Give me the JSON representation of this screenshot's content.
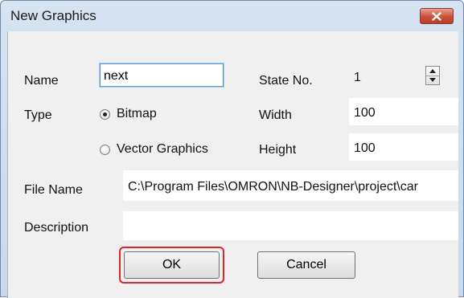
{
  "window": {
    "title": "New Graphics",
    "close_glyph": "close-x-icon"
  },
  "form": {
    "name": {
      "label": "Name",
      "value": "next"
    },
    "state_no": {
      "label": "State No.",
      "value": "1"
    },
    "type": {
      "label": "Type",
      "options": [
        {
          "label": "Bitmap",
          "selected": true
        },
        {
          "label": "Vector Graphics",
          "selected": false
        }
      ]
    },
    "width": {
      "label": "Width",
      "value": "100"
    },
    "height": {
      "label": "Height",
      "value": "100"
    },
    "file_name": {
      "label": "File Name",
      "value": "C:\\Program Files\\OMRON\\NB-Designer\\project\\car"
    },
    "description": {
      "label": "Description",
      "value": ""
    }
  },
  "buttons": {
    "ok": "OK",
    "cancel": "Cancel"
  },
  "colors": {
    "highlight": "#d6262e",
    "input_border": "#5b9bd5",
    "close_button": "#c9503a"
  }
}
